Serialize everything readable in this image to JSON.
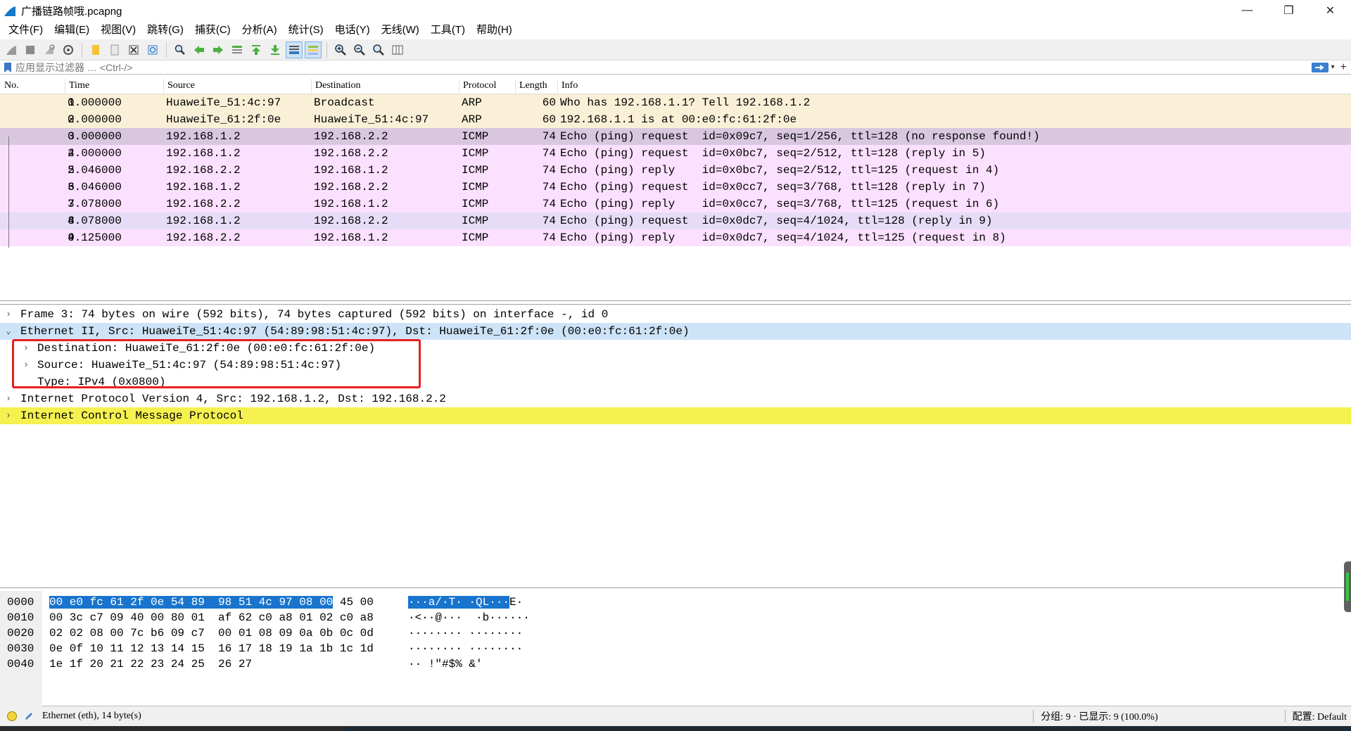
{
  "window": {
    "title": "广播链路帧哦.pcapng",
    "minimize": "—",
    "maximize": "❐",
    "close": "✕"
  },
  "menu": [
    "文件(F)",
    "编辑(E)",
    "视图(V)",
    "跳转(G)",
    "捕获(C)",
    "分析(A)",
    "统计(S)",
    "电话(Y)",
    "无线(W)",
    "工具(T)",
    "帮助(H)"
  ],
  "filter": {
    "placeholder": "应用显示过滤器 … <Ctrl-/>"
  },
  "packet_list": {
    "columns": [
      "No.",
      "Time",
      "Source",
      "Destination",
      "Protocol",
      "Length",
      "Info"
    ],
    "rows": [
      {
        "no": "1",
        "time": "0.000000",
        "src": "HuaweiTe_51:4c:97",
        "dst": "Broadcast",
        "proto": "ARP",
        "len": "60",
        "info": "Who has 192.168.1.1? Tell 192.168.1.2"
      },
      {
        "no": "2",
        "time": "0.000000",
        "src": "HuaweiTe_61:2f:0e",
        "dst": "HuaweiTe_51:4c:97",
        "proto": "ARP",
        "len": "60",
        "info": "192.168.1.1 is at 00:e0:fc:61:2f:0e"
      },
      {
        "no": "3",
        "time": "0.000000",
        "src": "192.168.1.2",
        "dst": "192.168.2.2",
        "proto": "ICMP",
        "len": "74",
        "info": "Echo (ping) request  id=0x09c7, seq=1/256, ttl=128 (no response found!)"
      },
      {
        "no": "4",
        "time": "2.000000",
        "src": "192.168.1.2",
        "dst": "192.168.2.2",
        "proto": "ICMP",
        "len": "74",
        "info": "Echo (ping) request  id=0x0bc7, seq=2/512, ttl=128 (reply in 5)"
      },
      {
        "no": "5",
        "time": "2.046000",
        "src": "192.168.2.2",
        "dst": "192.168.1.2",
        "proto": "ICMP",
        "len": "74",
        "info": "Echo (ping) reply    id=0x0bc7, seq=2/512, ttl=125 (request in 4)"
      },
      {
        "no": "6",
        "time": "3.046000",
        "src": "192.168.1.2",
        "dst": "192.168.2.2",
        "proto": "ICMP",
        "len": "74",
        "info": "Echo (ping) request  id=0x0cc7, seq=3/768, ttl=128 (reply in 7)"
      },
      {
        "no": "7",
        "time": "3.078000",
        "src": "192.168.2.2",
        "dst": "192.168.1.2",
        "proto": "ICMP",
        "len": "74",
        "info": "Echo (ping) reply    id=0x0cc7, seq=3/768, ttl=125 (request in 6)"
      },
      {
        "no": "8",
        "time": "4.078000",
        "src": "192.168.1.2",
        "dst": "192.168.2.2",
        "proto": "ICMP",
        "len": "74",
        "info": "Echo (ping) request  id=0x0dc7, seq=4/1024, ttl=128 (reply in 9)"
      },
      {
        "no": "9",
        "time": "4.125000",
        "src": "192.168.2.2",
        "dst": "192.168.1.2",
        "proto": "ICMP",
        "len": "74",
        "info": "Echo (ping) reply    id=0x0dc7, seq=4/1024, ttl=125 (request in 8)"
      }
    ]
  },
  "details": [
    {
      "arrow": "›",
      "text": "Frame 3: 74 bytes on wire (592 bits), 74 bytes captured (592 bits) on interface -, id 0"
    },
    {
      "arrow": "⌄",
      "text": "Ethernet II, Src: HuaweiTe_51:4c:97 (54:89:98:51:4c:97), Dst: HuaweiTe_61:2f:0e (00:e0:fc:61:2f:0e)"
    },
    {
      "arrow": "›",
      "text": "Destination: HuaweiTe_61:2f:0e (00:e0:fc:61:2f:0e)"
    },
    {
      "arrow": "›",
      "text": "Source: HuaweiTe_51:4c:97 (54:89:98:51:4c:97)"
    },
    {
      "arrow": "",
      "text": "Type: IPv4 (0x0800)"
    },
    {
      "arrow": "›",
      "text": "Internet Protocol Version 4, Src: 192.168.1.2, Dst: 192.168.2.2"
    },
    {
      "arrow": "›",
      "text": "Internet Control Message Protocol"
    }
  ],
  "hex": {
    "offsets": [
      "0000",
      "0010",
      "0020",
      "0030",
      "0040"
    ],
    "line0_sel": "00 e0 fc 61 2f 0e 54 89  98 51 4c 97 08 00",
    "line0_rest": " 45 00",
    "ascii0_sel": "···a/·T· ·QL···",
    "ascii0_rest": "E·",
    "lines": [
      "00 3c c7 09 40 00 80 01  af 62 c0 a8 01 02 c0 a8",
      "02 02 08 00 7c b6 09 c7  00 01 08 09 0a 0b 0c 0d",
      "0e 0f 10 11 12 13 14 15  16 17 18 19 1a 1b 1c 1d",
      "1e 1f 20 21 22 23 24 25  26 27"
    ],
    "ascii": [
      "·<··@···  ·b······",
      "········ ········",
      "········ ········",
      "·· !\"#$% &'"
    ]
  },
  "status": {
    "left": "Ethernet (eth), 14 byte(s)",
    "packets": "分组: 9 · 已显示: 9 (100.0%)",
    "profile": "配置: Default"
  }
}
